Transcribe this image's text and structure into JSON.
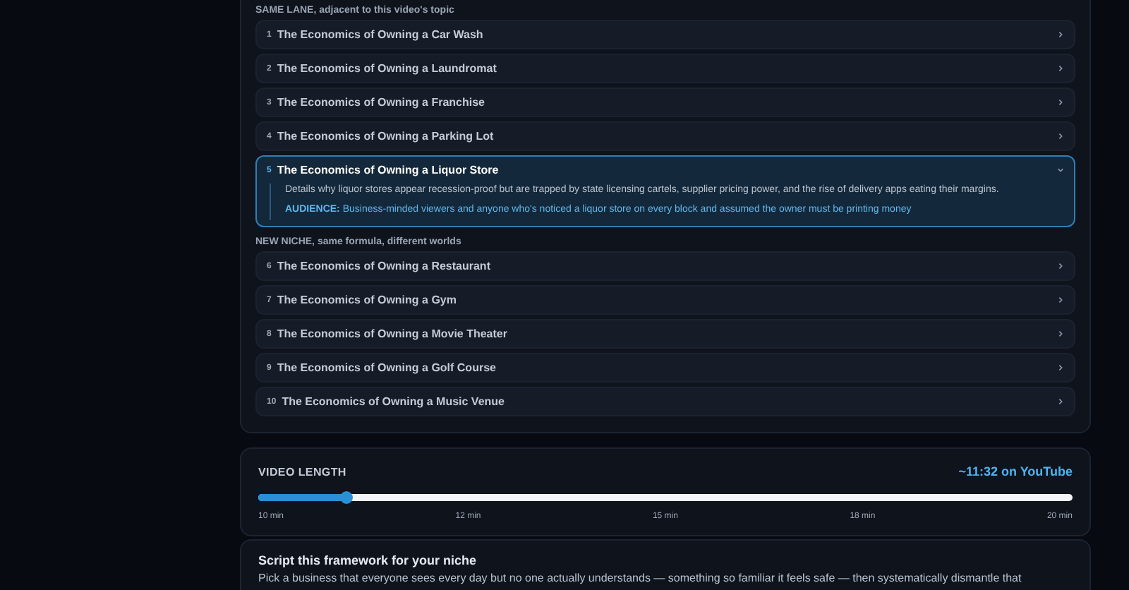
{
  "groups": [
    {
      "label": "SAME LANE, adjacent to this video's topic",
      "items": [
        {
          "number": "1",
          "title": "The Economics of Owning a Car Wash",
          "expanded": false
        },
        {
          "number": "2",
          "title": "The Economics of Owning a Laundromat",
          "expanded": false
        },
        {
          "number": "3",
          "title": "The Economics of Owning a Franchise",
          "expanded": false
        },
        {
          "number": "4",
          "title": "The Economics of Owning a Parking Lot",
          "expanded": false
        },
        {
          "number": "5",
          "title": "The Economics of Owning a Liquor Store",
          "expanded": true,
          "description": "Details why liquor stores appear recession-proof but are trapped by state licensing cartels, supplier pricing power, and the rise of delivery apps eating their margins.",
          "audience_label": "AUDIENCE:",
          "audience": "Business-minded viewers and anyone who's noticed a liquor store on every block and assumed the owner must be printing money"
        }
      ]
    },
    {
      "label": "NEW NICHE, same formula, different worlds",
      "items": [
        {
          "number": "6",
          "title": "The Economics of Owning a Restaurant",
          "expanded": false
        },
        {
          "number": "7",
          "title": "The Economics of Owning a Gym",
          "expanded": false
        },
        {
          "number": "8",
          "title": "The Economics of Owning a Movie Theater",
          "expanded": false
        },
        {
          "number": "9",
          "title": "The Economics of Owning a Golf Course",
          "expanded": false
        },
        {
          "number": "10",
          "title": "The Economics of Owning a Music Venue",
          "expanded": false
        }
      ]
    }
  ],
  "video_length": {
    "title": "VIDEO LENGTH",
    "reading": "~11:32 on YouTube",
    "level": 0.107,
    "ticks": [
      "10 min",
      "12 min",
      "15 min",
      "18 min",
      "20 min"
    ]
  },
  "script_card": {
    "title": "Script this framework for your niche",
    "text": "Pick a business that everyone sees every day but no one actually understands — something so familiar it feels safe — then systematically dismantle that"
  }
}
